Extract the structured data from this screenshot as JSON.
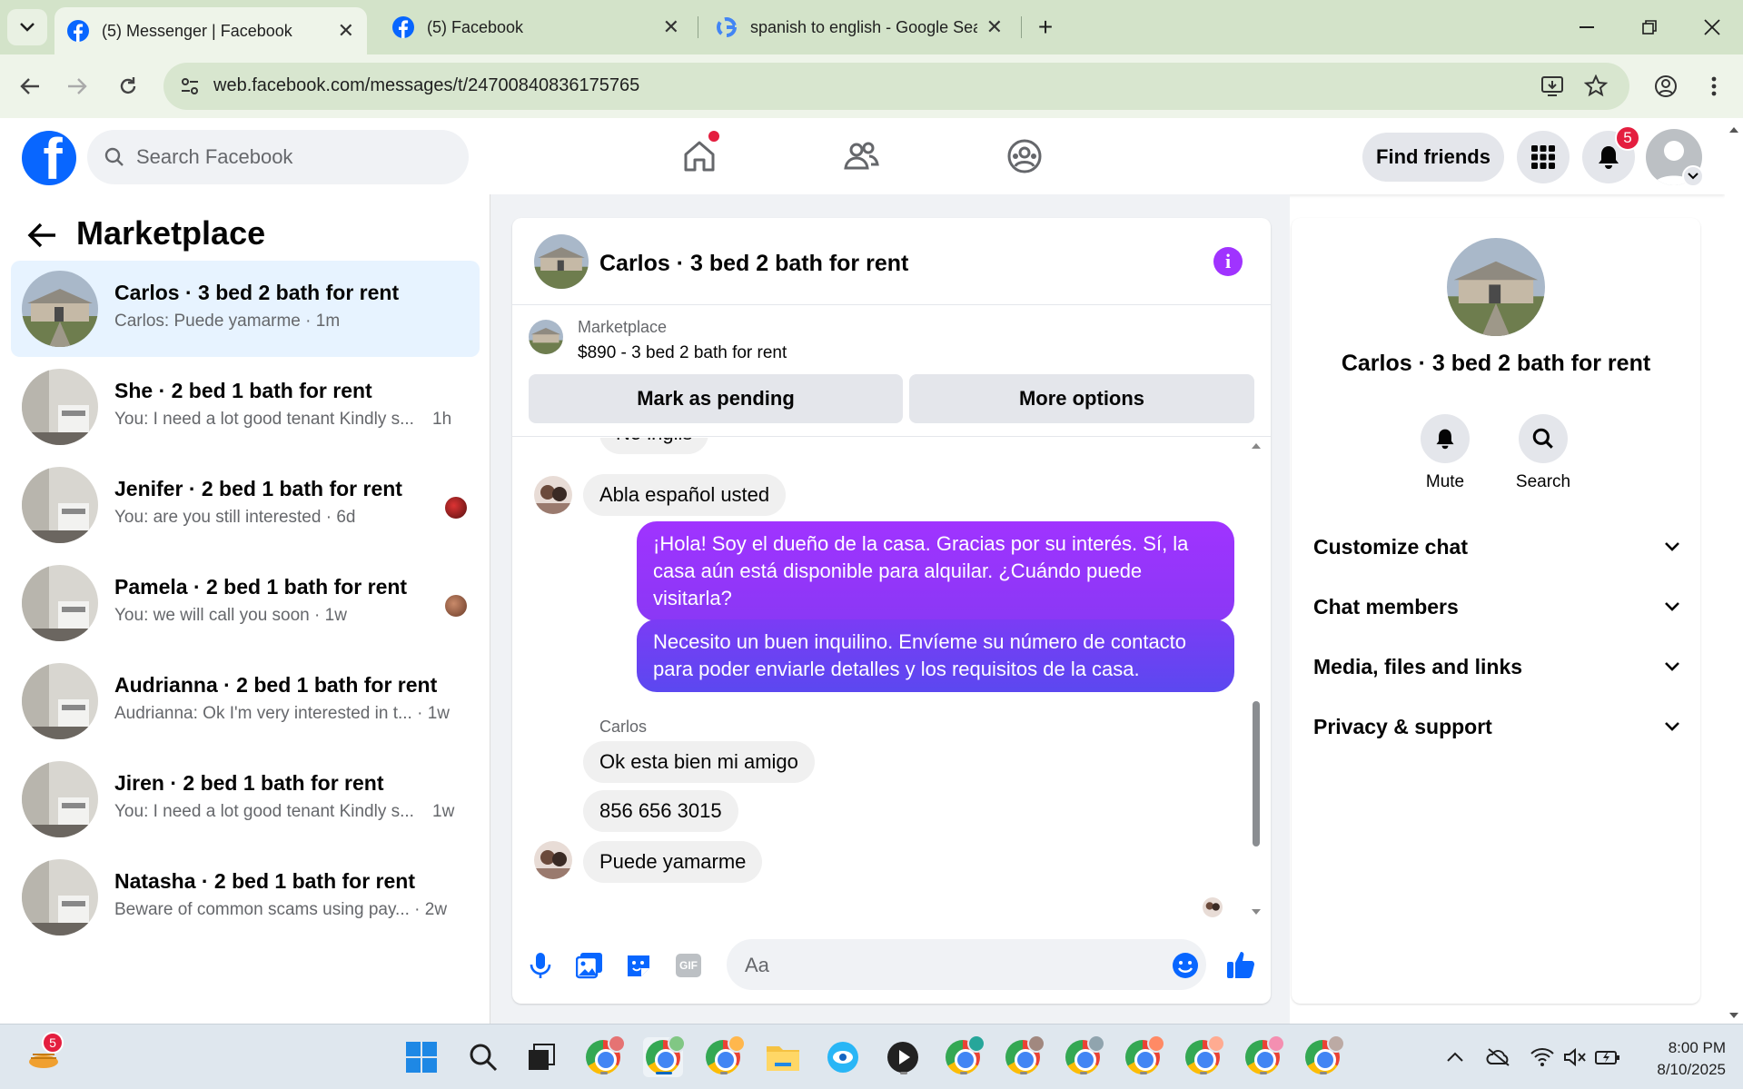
{
  "browser": {
    "tabs": [
      {
        "title": "(5) Messenger | Facebook",
        "active": true
      },
      {
        "title": "(5) Facebook",
        "active": false
      },
      {
        "title": "spanish to english - Google Sea",
        "active": false
      }
    ],
    "url": "web.facebook.com/messages/t/24700840836175765"
  },
  "fb": {
    "search_placeholder": "Search Facebook",
    "find_friends": "Find friends",
    "notifications_count": "5",
    "brand_color": "#0866ff"
  },
  "left": {
    "title": "Marketplace",
    "conversations": [
      {
        "name": "Carlos · 3 bed 2 bath for rent",
        "preview": "Carlos: Puede yamarme · 1m",
        "selected": true
      },
      {
        "name": "She · 2 bed 1 bath for rent",
        "preview": "You: I need a lot good tenant Kindly s...",
        "time": "1h"
      },
      {
        "name": "Jenifer · 2 bed 1 bath for rent",
        "preview": "You: are you still interested · 6d"
      },
      {
        "name": "Pamela · 2 bed 1 bath for rent",
        "preview": "You: we will call you soon · 1w"
      },
      {
        "name": "Audrianna · 2 bed 1 bath for rent",
        "preview": "Audrianna: Ok I'm very interested in t... · 1w"
      },
      {
        "name": "Jiren · 2 bed 1 bath for rent",
        "preview": "You: I need a lot good tenant Kindly s...",
        "time": "1w"
      },
      {
        "name": "Natasha · 2 bed 1 bath for rent",
        "preview": "Beware of common scams using pay... · 2w"
      }
    ]
  },
  "chat": {
    "title": "Carlos · 3 bed 2 bath for rent",
    "listing_label": "Marketplace",
    "listing_price": "$890 - 3 bed 2 bath for rent",
    "mark_pending": "Mark as pending",
    "more_options": "More options",
    "messages": {
      "m0": "No inglis",
      "m1": "Abla español usted",
      "m2": "¡Hola! Soy el dueño de la casa. Gracias por su interés. Sí, la casa aún está disponible para alquilar. ¿Cuándo puede visitarla?",
      "m3": "Necesito un buen inquilino. Envíeme su número de contacto para poder enviarle detalles y los requisitos de la casa.",
      "sender": "Carlos",
      "m4": "Ok esta bien mi amigo",
      "m5": "856 656 3015",
      "m6": "Puede yamarme"
    },
    "input_placeholder": "Aa",
    "gif_label": "GIF"
  },
  "right": {
    "name": "Carlos · 3 bed 2 bath for rent",
    "mute": "Mute",
    "search": "Search",
    "sections": [
      "Customize chat",
      "Chat members",
      "Media, files and links",
      "Privacy & support"
    ]
  },
  "taskbar": {
    "time": "8:00 PM",
    "date": "8/10/2025",
    "weather_badge": "5"
  }
}
